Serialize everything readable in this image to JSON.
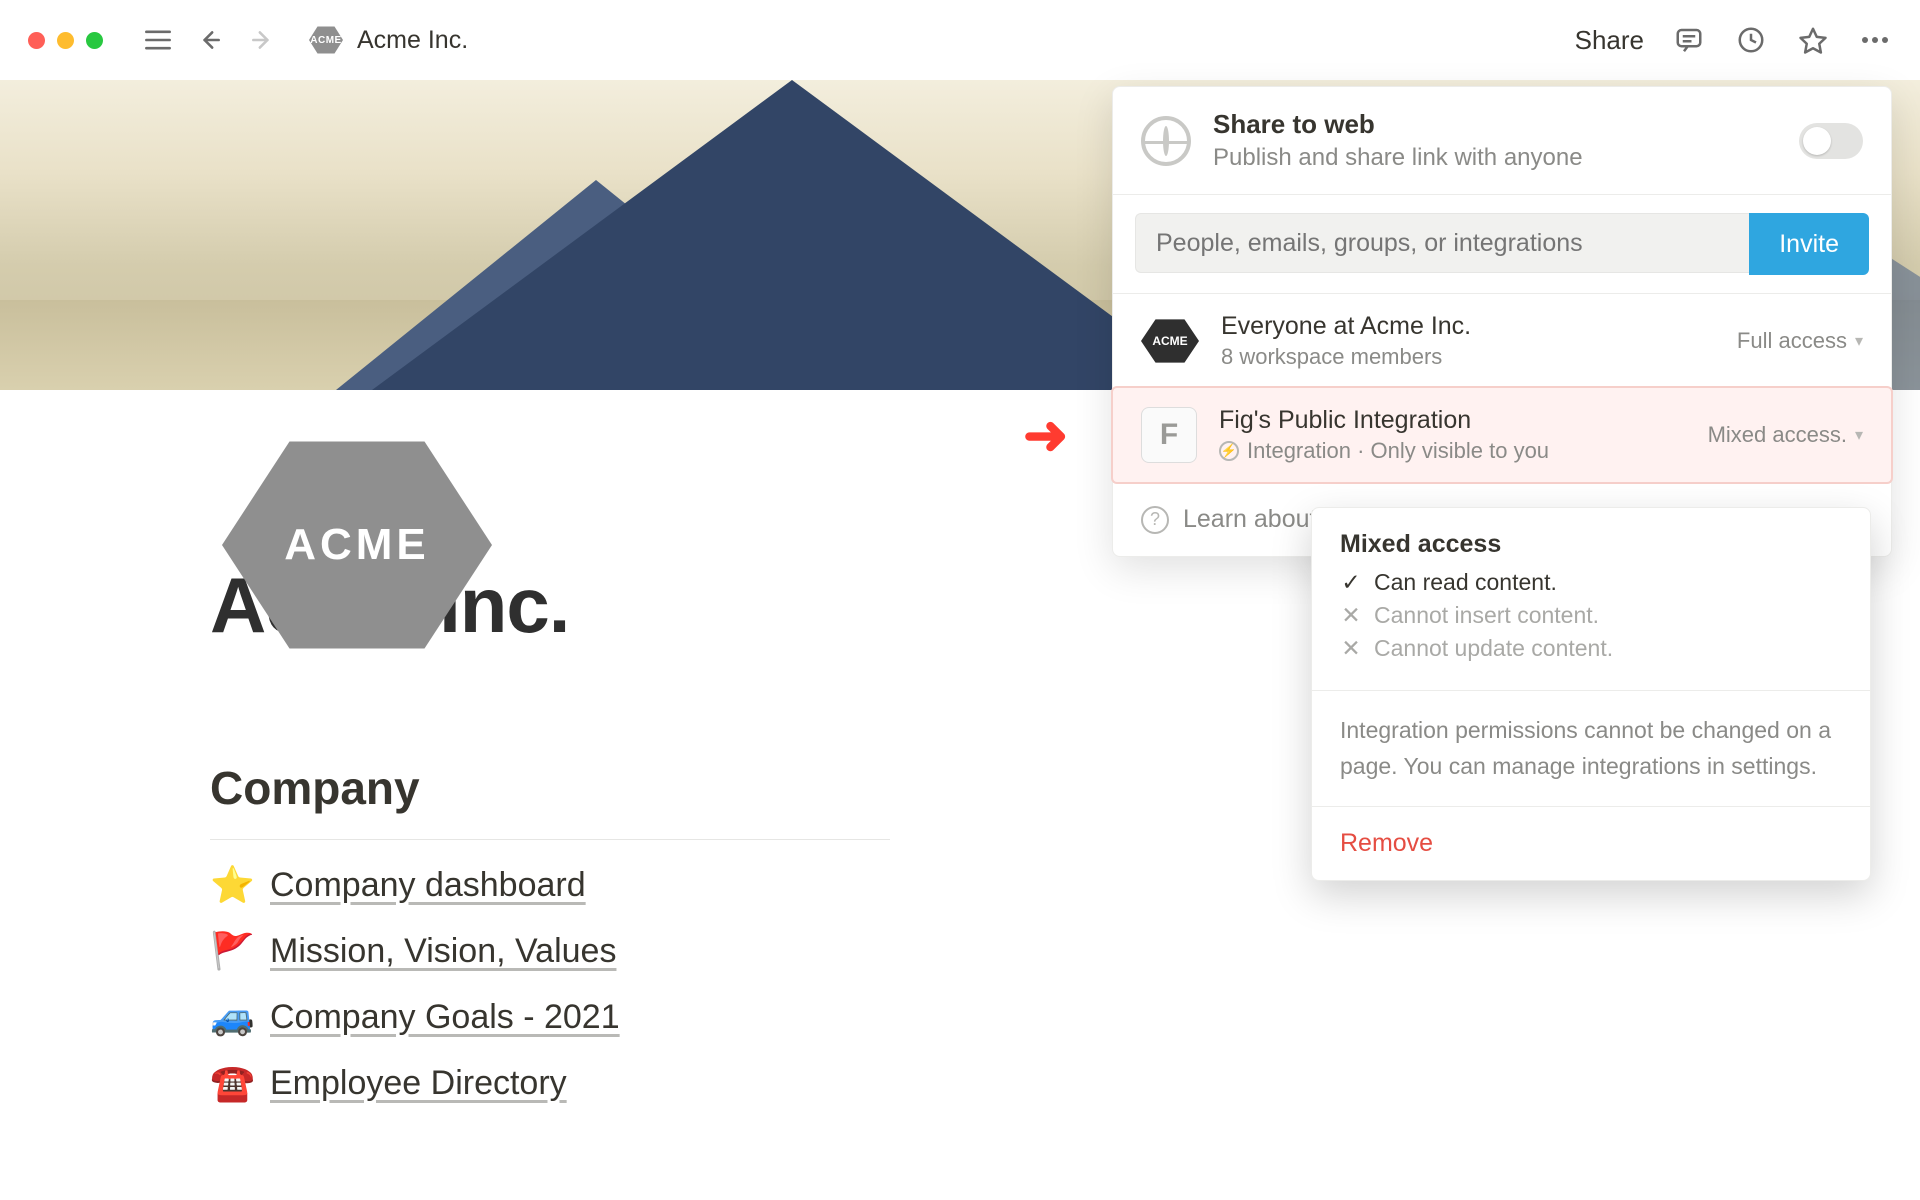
{
  "titlebar": {
    "breadcrumb": "Acme Inc.",
    "share": "Share",
    "logo_text": "ACME"
  },
  "page": {
    "logo_text": "ACME",
    "title": "Acme Inc.",
    "section_heading": "Company",
    "links": [
      {
        "emoji": "⭐",
        "label": "Company dashboard"
      },
      {
        "emoji": "🚩",
        "label": "Mission, Vision, Values"
      },
      {
        "emoji": "🚙",
        "label": "Company Goals - 2021"
      },
      {
        "emoji": "☎️",
        "label": "Employee Directory"
      }
    ]
  },
  "share_panel": {
    "web_title": "Share to web",
    "web_sub": "Publish and share link with anyone",
    "invite_placeholder": "People, emails, groups, or integrations",
    "invite_button": "Invite",
    "everyone": {
      "title": "Everyone at Acme Inc.",
      "sub": "8 workspace members",
      "access": "Full access"
    },
    "integration": {
      "letter": "F",
      "title": "Fig's Public Integration",
      "sub": "Integration · Only visible to you",
      "access": "Mixed access."
    },
    "learn": "Learn about s",
    "perm": {
      "heading": "Mixed access",
      "can": "Can read content.",
      "cannot1": "Cannot insert content.",
      "cannot2": "Cannot update content.",
      "note": "Integration permissions cannot be changed on a page. You can manage integrations in settings.",
      "remove": "Remove"
    }
  }
}
